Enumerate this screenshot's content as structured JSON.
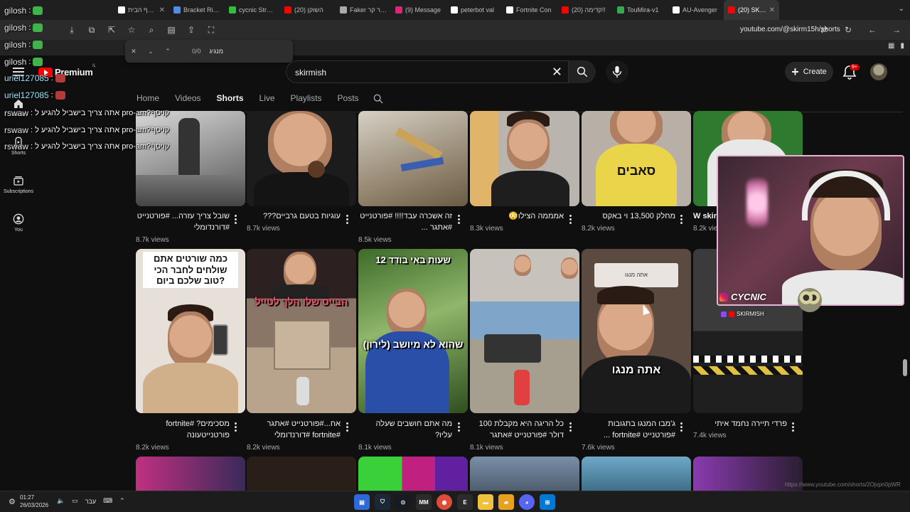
{
  "tabs": [
    {
      "label": "דף הבית / X",
      "color": "#ffffff"
    },
    {
      "label": "Bracket Rival",
      "color": "#4f8de6"
    },
    {
      "label": "cycnic Stream",
      "color": "#2fbf3a"
    },
    {
      "label": "(20) השוקן",
      "color": "#ff0000"
    },
    {
      "label": "Faker לבקר קר",
      "color": "#aaaaaa"
    },
    {
      "label": "(9) Message",
      "color": "#d62976"
    },
    {
      "label": "peterbot val",
      "color": "#ffffff"
    },
    {
      "label": "Fortnite Con",
      "color": "#ffffff"
    },
    {
      "label": "(20) קדימה!!",
      "color": "#ff0000"
    },
    {
      "label": "TouMira-v1",
      "color": "#34a853"
    },
    {
      "label": "AU-Avenger",
      "color": "#ffffff"
    },
    {
      "label": "(20) SKIRMI",
      "color": "#ff0000"
    }
  ],
  "browser": {
    "url": "youtube.com/@skirm15h/shorts"
  },
  "findbar": {
    "count": "0/0",
    "term": "מנגיג"
  },
  "chat": [
    {
      "name": "gilosh",
      "msg": ":",
      "emote": "g"
    },
    {
      "name": "gilosh",
      "msg": ":",
      "emote": "g"
    },
    {
      "name": "gilosh",
      "msg": ":",
      "emote": "g"
    },
    {
      "name": "gilosh",
      "msg": ":",
      "emote": "g"
    },
    {
      "name": "uriel127085",
      "msg": ":",
      "emote": "r"
    },
    {
      "name": "uriel127085",
      "msg": ":",
      "emote": "r"
    },
    {
      "name": "rswaw",
      "msg": ": אתה צריך בישביל להגיע ל pro-am?קויסף"
    },
    {
      "name": "rswaw",
      "msg": ": אתה צריך בישביל להגיע ל pro-am?קויסף"
    },
    {
      "name": "rswaw",
      "msg": ": אתה צריך בישביל להגיע ל pro-am?קויסף"
    }
  ],
  "youtube": {
    "premium_label": "Premium",
    "premium_region": "IL",
    "search_value": "skirmish",
    "create_label": "Create",
    "notif_badge": "9+",
    "guide": [
      {
        "label": "Home"
      },
      {
        "label": "Shorts"
      },
      {
        "label": "Subscriptions"
      },
      {
        "label": "You"
      }
    ],
    "channel_tabs": [
      "Home",
      "Videos",
      "Shorts",
      "Live",
      "Playlists",
      "Posts"
    ]
  },
  "shorts": [
    {
      "title": "שובל צריך עזרה... #פורטנייט #דורנדומלי",
      "views": "8.7k views"
    },
    {
      "title": "עוגיות בטעם גרביים???",
      "views": "8.7k views"
    },
    {
      "title": "זה אשכרה עבד!!!! #פורטנייט #אתגר ...",
      "views": "8.5k views"
    },
    {
      "title": "אמממה הצילו😳",
      "views": "8.3k views"
    },
    {
      "title": "מחלק 13,500 וי באקס",
      "views": "8.2k views"
    },
    {
      "title": "W skir",
      "views": "8.2k vie"
    },
    {
      "title": "מסכימים? #fortnite פורטנייטעונה",
      "views": "8.2k views",
      "overlay": "כמה שורטים אתם שולחים לחבר הכי טוב שלכם ביום?"
    },
    {
      "title": "אח...#פורטנייט #אתגר #fortnite #דורנדומלי",
      "views": "8.2k views",
      "overlay": "הבייס שלו הלך לטייל"
    },
    {
      "title": "מה אתם חושבים שעלה עליו?",
      "views": "8.1k views",
      "overlay": "12 שעות באי בודד",
      "overlay2": "(לירון) שהוא לא מיושב"
    },
    {
      "title": "כל הריגה היא מקבלת 100 דולר #פורטנייט #אתגר",
      "views": "8.1k views"
    },
    {
      "title": "ג'מבו המנגו בתגובות #פורטנייט #fortnite ...",
      "views": "7.6k views",
      "overlay": "אתה מנגו",
      "overlay_small": "אתה מנגו"
    },
    {
      "title": "פרדי תיירה נחמד איתי",
      "views": "7.4k views"
    }
  ],
  "thumb_captions": {
    "r1c5": "סאבים"
  },
  "webcam": {
    "name": "CYCNIC",
    "tag": "SKIRMISH"
  },
  "taskbar": {
    "time": "01:27",
    "date": "26/03/2026",
    "lang": "עבר"
  },
  "status_url": "https://www.youtube.com/shorts/2Ojvpn0pWR"
}
